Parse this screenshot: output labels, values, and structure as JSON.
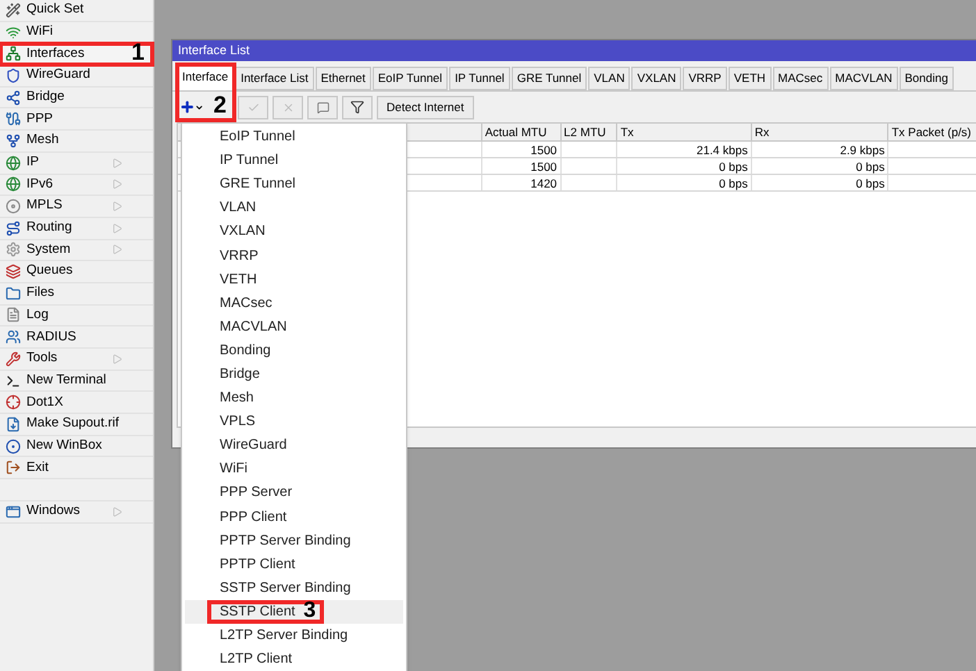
{
  "sidebar": {
    "items": [
      {
        "label": "Quick Set",
        "submenu": false,
        "selected": false
      },
      {
        "label": "WiFi",
        "submenu": false,
        "selected": false
      },
      {
        "label": "Interfaces",
        "submenu": false,
        "selected": true
      },
      {
        "label": "WireGuard",
        "submenu": false,
        "selected": false
      },
      {
        "label": "Bridge",
        "submenu": false,
        "selected": false
      },
      {
        "label": "PPP",
        "submenu": false,
        "selected": false
      },
      {
        "label": "Mesh",
        "submenu": false,
        "selected": false
      },
      {
        "label": "IP",
        "submenu": true,
        "selected": false
      },
      {
        "label": "IPv6",
        "submenu": true,
        "selected": false
      },
      {
        "label": "MPLS",
        "submenu": true,
        "selected": false
      },
      {
        "label": "Routing",
        "submenu": true,
        "selected": false
      },
      {
        "label": "System",
        "submenu": true,
        "selected": false
      },
      {
        "label": "Queues",
        "submenu": false,
        "selected": false
      },
      {
        "label": "Files",
        "submenu": false,
        "selected": false
      },
      {
        "label": "Log",
        "submenu": false,
        "selected": false
      },
      {
        "label": "RADIUS",
        "submenu": false,
        "selected": false
      },
      {
        "label": "Tools",
        "submenu": true,
        "selected": false
      },
      {
        "label": "New Terminal",
        "submenu": false,
        "selected": false
      },
      {
        "label": "Dot1X",
        "submenu": false,
        "selected": false
      },
      {
        "label": "Make Supout.rif",
        "submenu": false,
        "selected": false
      },
      {
        "label": "New WinBox",
        "submenu": false,
        "selected": false
      },
      {
        "label": "Exit",
        "submenu": false,
        "selected": false
      }
    ],
    "bottom_items": [
      {
        "label": "Windows",
        "submenu": true,
        "selected": false
      }
    ]
  },
  "window": {
    "title": "Interface List",
    "tabs": [
      {
        "label": "Interface",
        "selected": true
      },
      {
        "label": "Interface List",
        "selected": false
      },
      {
        "label": "Ethernet",
        "selected": false
      },
      {
        "label": "EoIP Tunnel",
        "selected": false
      },
      {
        "label": "IP Tunnel",
        "selected": false
      },
      {
        "label": "GRE Tunnel",
        "selected": false
      },
      {
        "label": "VLAN",
        "selected": false
      },
      {
        "label": "VXLAN",
        "selected": false
      },
      {
        "label": "VRRP",
        "selected": false
      },
      {
        "label": "VETH",
        "selected": false
      },
      {
        "label": "MACsec",
        "selected": false
      },
      {
        "label": "MACVLAN",
        "selected": false
      },
      {
        "label": "Bonding",
        "selected": false
      }
    ],
    "toolbar": {
      "detect_button": "Detect Internet"
    },
    "table": {
      "columns": [
        "Actual MTU",
        "L2 MTU",
        "Tx",
        "Rx",
        "Tx Packet (p/s)"
      ],
      "rows": [
        [
          "1500",
          "",
          "21.4 kbps",
          "2.9 kbps",
          ""
        ],
        [
          "1500",
          "",
          "0 bps",
          "0 bps",
          ""
        ],
        [
          "1420",
          "",
          "0 bps",
          "0 bps",
          ""
        ]
      ]
    }
  },
  "add_menu": {
    "items": [
      {
        "label": "EoIP Tunnel",
        "selected": false
      },
      {
        "label": "IP Tunnel",
        "selected": false
      },
      {
        "label": "GRE Tunnel",
        "selected": false
      },
      {
        "label": "VLAN",
        "selected": false
      },
      {
        "label": "VXLAN",
        "selected": false
      },
      {
        "label": "VRRP",
        "selected": false
      },
      {
        "label": "VETH",
        "selected": false
      },
      {
        "label": "MACsec",
        "selected": false
      },
      {
        "label": "MACVLAN",
        "selected": false
      },
      {
        "label": "Bonding",
        "selected": false
      },
      {
        "label": "Bridge",
        "selected": false
      },
      {
        "label": "Mesh",
        "selected": false
      },
      {
        "label": "VPLS",
        "selected": false
      },
      {
        "label": "WireGuard",
        "selected": false
      },
      {
        "label": "WiFi",
        "selected": false
      },
      {
        "label": "PPP Server",
        "selected": false
      },
      {
        "label": "PPP Client",
        "selected": false
      },
      {
        "label": "PPTP Server Binding",
        "selected": false
      },
      {
        "label": "PPTP Client",
        "selected": false
      },
      {
        "label": "SSTP Server Binding",
        "selected": false
      },
      {
        "label": "SSTP Client",
        "selected": true
      },
      {
        "label": "L2TP Server Binding",
        "selected": false
      },
      {
        "label": "L2TP Client",
        "selected": false
      }
    ]
  },
  "annotations": [
    {
      "label": "1"
    },
    {
      "label": "2"
    },
    {
      "label": "3"
    }
  ]
}
